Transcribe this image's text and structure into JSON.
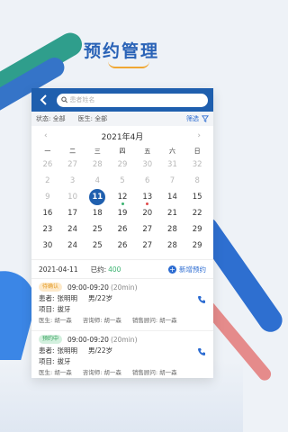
{
  "page_title": "预约管理",
  "search": {
    "placeholder": "患者姓名"
  },
  "filters": {
    "status_label": "状态:",
    "status_value": "全部",
    "doctor_label": "医生:",
    "doctor_value": "全部",
    "filter_label": "筛选"
  },
  "calendar": {
    "month_title": "2021年4月",
    "prev": "‹",
    "next": "›",
    "weekdays": [
      "一",
      "二",
      "三",
      "四",
      "五",
      "六",
      "日"
    ],
    "weeks": [
      [
        "26",
        "27",
        "28",
        "29",
        "30",
        "31",
        "32"
      ],
      [
        "2",
        "3",
        "4",
        "5",
        "6",
        "7",
        "8"
      ],
      [
        "9",
        "10",
        "11",
        "12",
        "13",
        "14",
        "15"
      ],
      [
        "16",
        "17",
        "18",
        "19",
        "20",
        "21",
        "22"
      ],
      [
        "23",
        "24",
        "25",
        "26",
        "27",
        "28",
        "29"
      ],
      [
        "30",
        "24",
        "25",
        "26",
        "27",
        "28",
        "29"
      ]
    ]
  },
  "summary": {
    "date": "2021-04-11",
    "booked_label": "已约:",
    "booked_count": "400",
    "add_label": "新增预约"
  },
  "appointments": [
    {
      "status": "待确认",
      "time": "09:00-09:20",
      "duration": "(20min)",
      "patient_label": "患者:",
      "patient_name": "张明明",
      "patient_info": "男/22岁",
      "project_label": "项目:",
      "project": "拔牙",
      "doctor_label": "医生:",
      "doctor": "胡一森",
      "consultant_label": "咨询师:",
      "consultant": "胡一森",
      "sales_label": "销售顾问:",
      "sales": "胡一森"
    },
    {
      "status": "预约中",
      "time": "09:00-09:20",
      "duration": "(20min)",
      "patient_label": "患者:",
      "patient_name": "张明明",
      "patient_info": "男/22岁",
      "project_label": "项目:",
      "project": "拔牙",
      "doctor_label": "医生:",
      "doctor": "胡一森",
      "consultant_label": "咨询师:",
      "consultant": "胡一森",
      "sales_label": "销售顾问:",
      "sales": "胡一森"
    }
  ],
  "colors": {
    "primary": "#1f5fae",
    "accent_blue": "#2b6bd1",
    "pending": "#e39a23",
    "booked": "#2f9e58"
  }
}
